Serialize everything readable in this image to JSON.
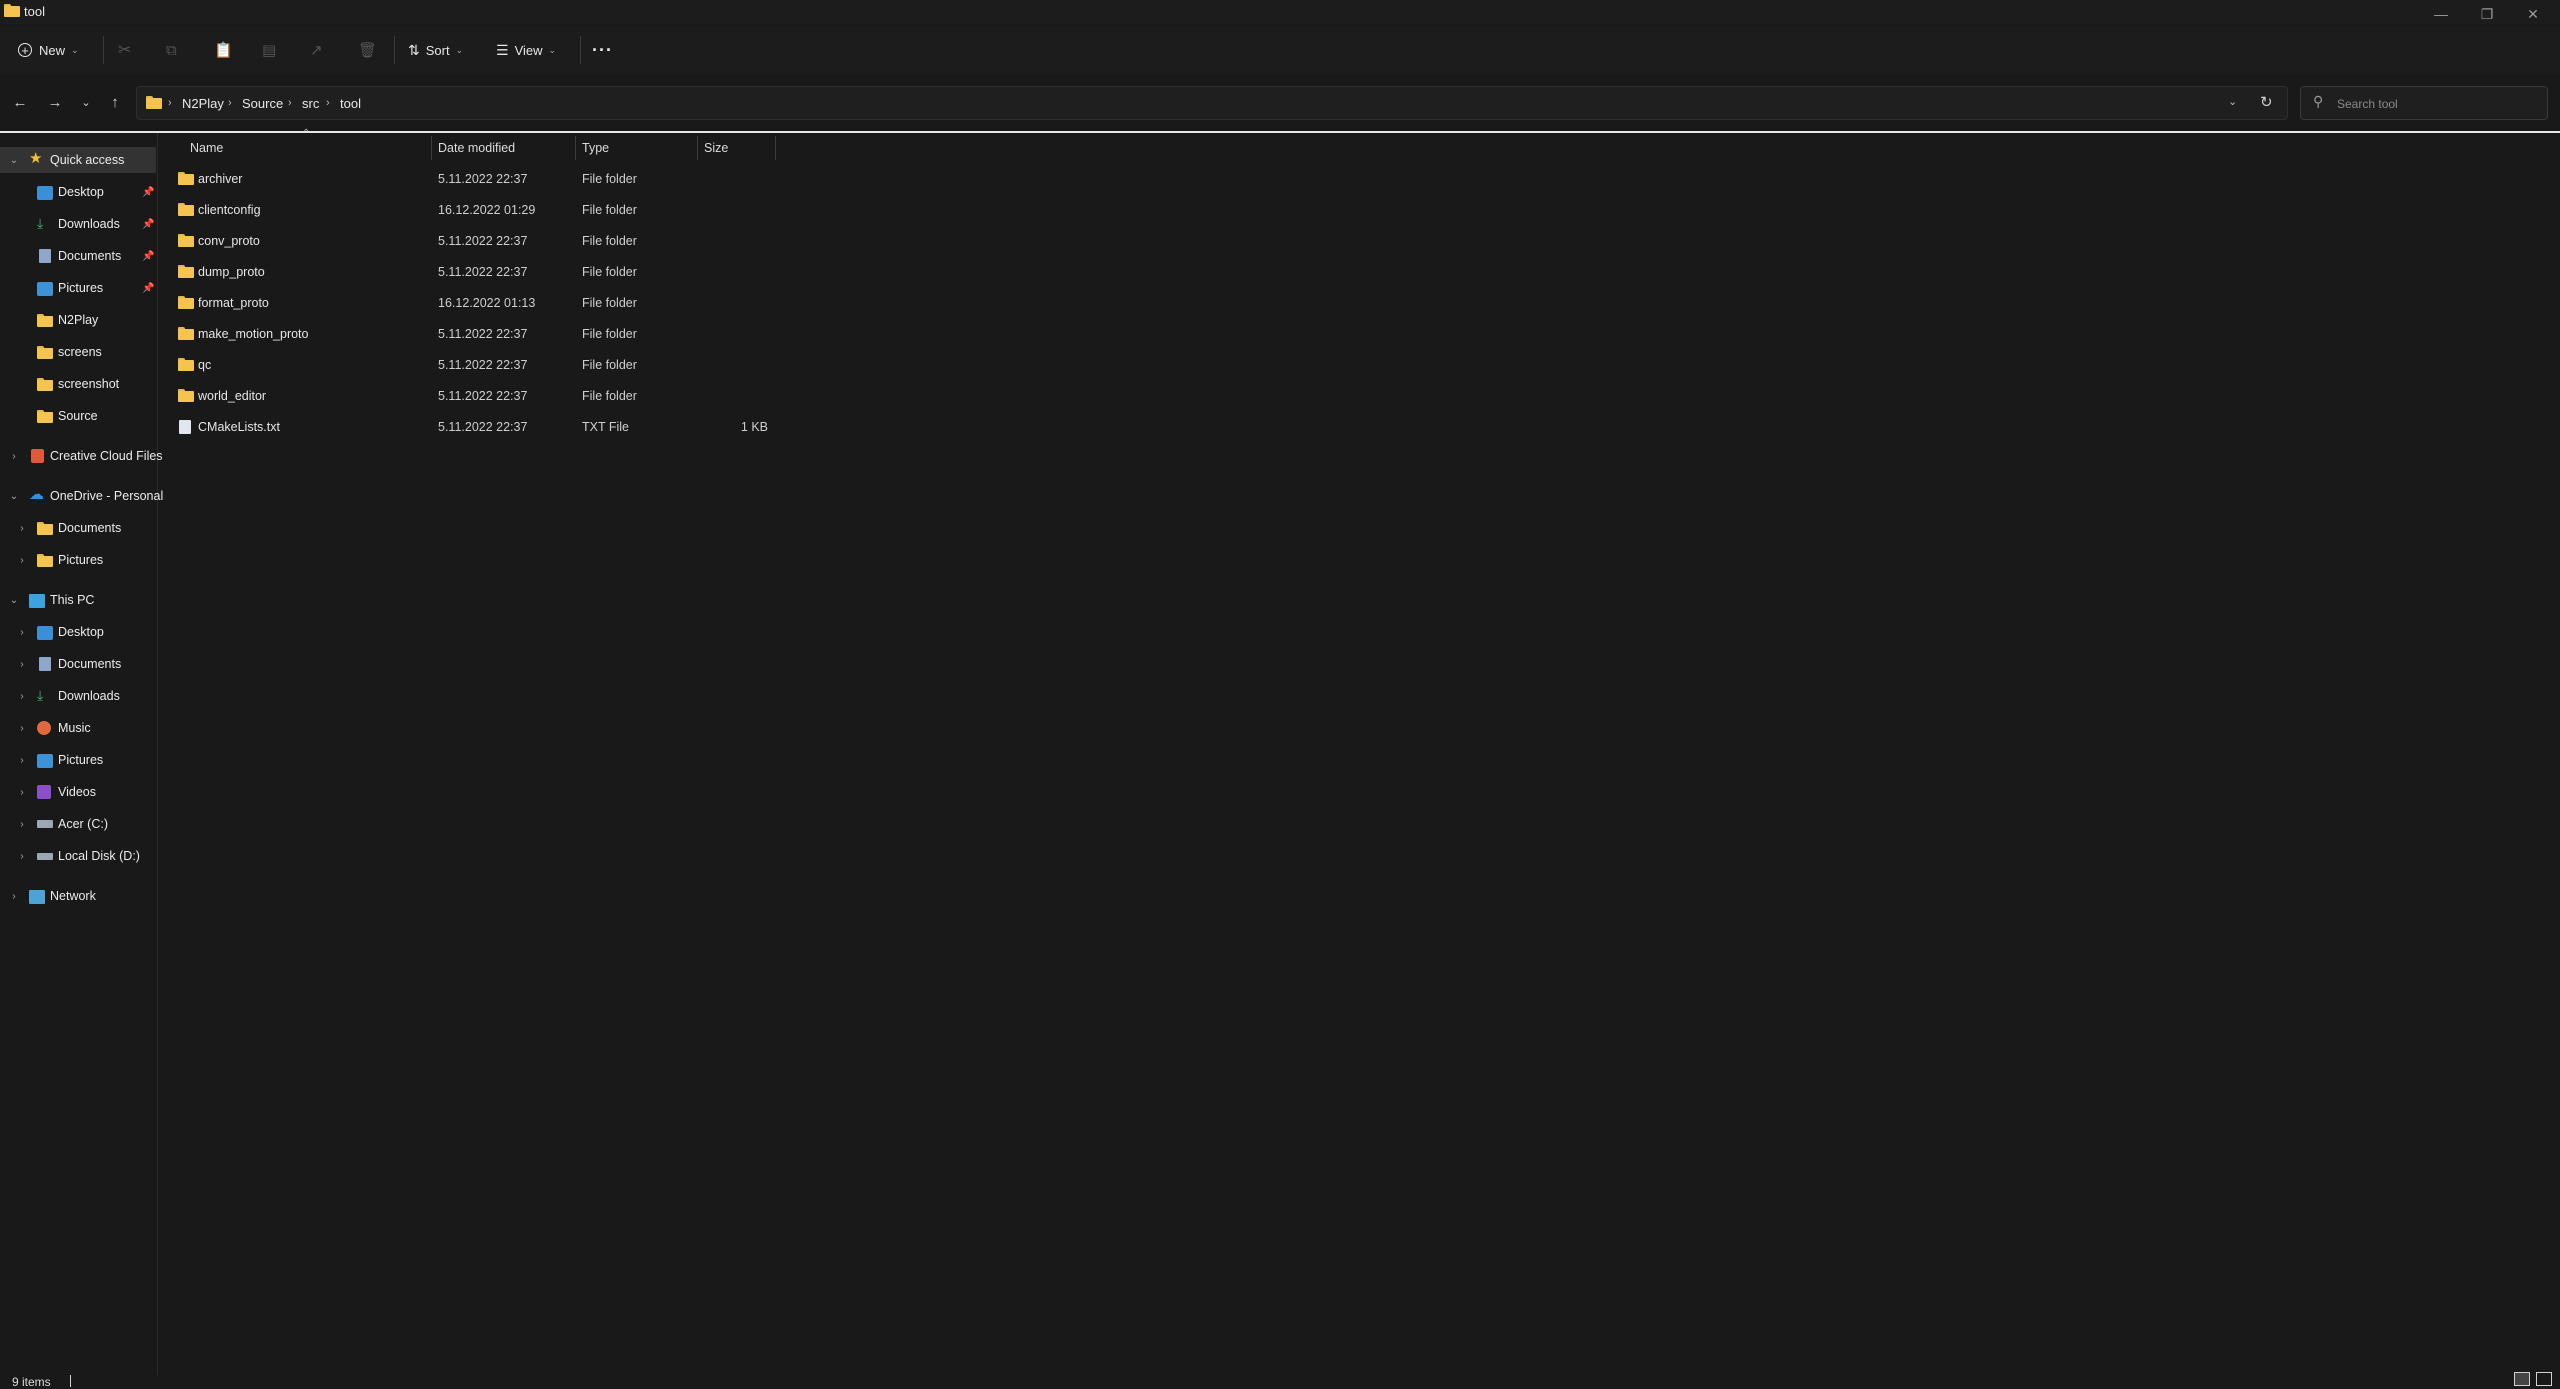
{
  "window": {
    "title": "tool"
  },
  "toolbar": {
    "new_label": "New",
    "sort_label": "Sort",
    "view_label": "View",
    "more_label": "···"
  },
  "address": {
    "crumbs": [
      "N2Play",
      "Source",
      "src",
      "tool"
    ]
  },
  "search": {
    "placeholder": "Search tool"
  },
  "sidebar": {
    "quick_access": "Quick access",
    "qa_items": [
      "Desktop",
      "Downloads",
      "Documents",
      "Pictures",
      "N2Play",
      "screens",
      "screenshot",
      "Source"
    ],
    "creative_cloud": "Creative Cloud Files",
    "onedrive": "OneDrive - Personal",
    "onedrive_items": [
      "Documents",
      "Pictures"
    ],
    "this_pc": "This PC",
    "pc_items": [
      "Desktop",
      "Documents",
      "Downloads",
      "Music",
      "Pictures",
      "Videos",
      "Acer (C:)",
      "Local Disk (D:)"
    ],
    "network": "Network"
  },
  "columns": {
    "name": "Name",
    "date": "Date modified",
    "type": "Type",
    "size": "Size"
  },
  "files": [
    {
      "name": "archiver",
      "date": "5.11.2022 22:37",
      "type": "File folder",
      "size": ""
    },
    {
      "name": "clientconfig",
      "date": "16.12.2022 01:29",
      "type": "File folder",
      "size": ""
    },
    {
      "name": "conv_proto",
      "date": "5.11.2022 22:37",
      "type": "File folder",
      "size": ""
    },
    {
      "name": "dump_proto",
      "date": "5.11.2022 22:37",
      "type": "File folder",
      "size": ""
    },
    {
      "name": "format_proto",
      "date": "16.12.2022 01:13",
      "type": "File folder",
      "size": ""
    },
    {
      "name": "make_motion_proto",
      "date": "5.11.2022 22:37",
      "type": "File folder",
      "size": ""
    },
    {
      "name": "qc",
      "date": "5.11.2022 22:37",
      "type": "File folder",
      "size": ""
    },
    {
      "name": "world_editor",
      "date": "5.11.2022 22:37",
      "type": "File folder",
      "size": ""
    },
    {
      "name": "CMakeLists.txt",
      "date": "5.11.2022 22:37",
      "type": "TXT File",
      "size": "1 KB"
    }
  ],
  "status": {
    "items": "9 items"
  }
}
